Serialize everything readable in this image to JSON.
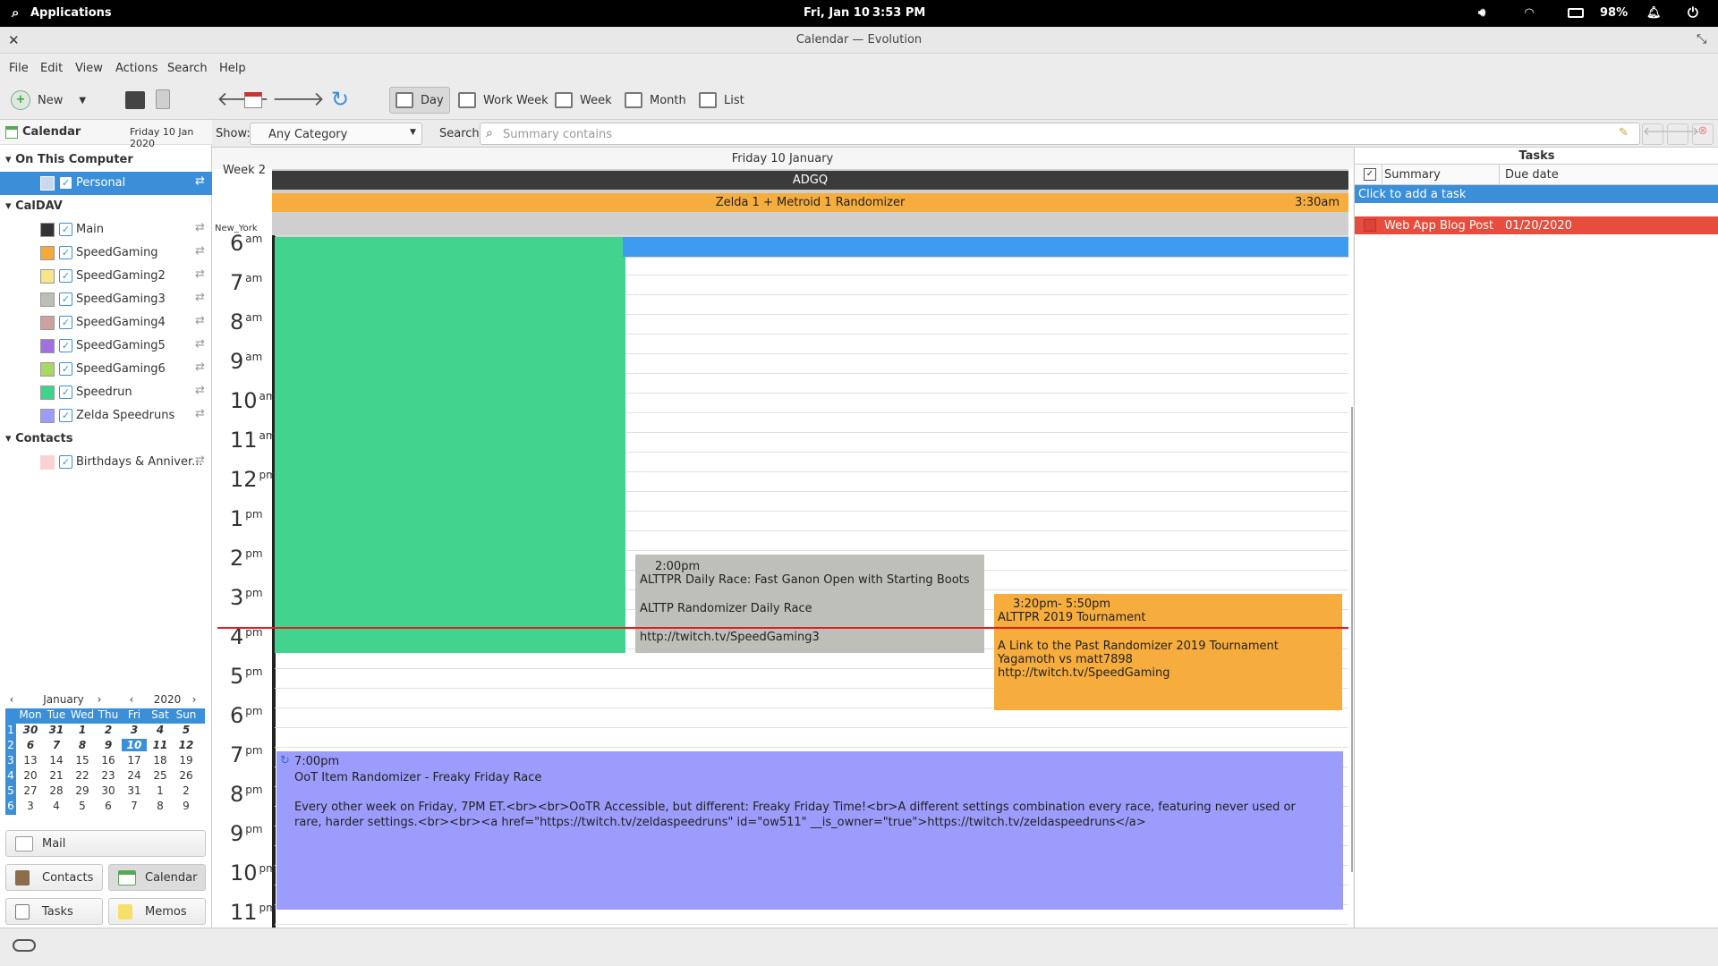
{
  "topbar": {
    "applications": "Applications",
    "date": "Fri, Jan 10",
    "time": "3:53 PM",
    "battery": "98%"
  },
  "window": {
    "title": "Calendar — Evolution"
  },
  "menu": [
    "File",
    "Edit",
    "View",
    "Actions",
    "Search",
    "Help"
  ],
  "toolbar": {
    "new_label": "New",
    "views": [
      "Day",
      "Work Week",
      "Week",
      "Month",
      "List"
    ],
    "active_view": "Day"
  },
  "sidebar": {
    "title": "Calendar",
    "date": "Friday 10 Jan 2020",
    "groups": [
      {
        "name": "On This Computer",
        "items": [
          {
            "name": "Personal",
            "color": "#c8d8ee",
            "selected": true
          }
        ]
      },
      {
        "name": "CalDAV",
        "items": [
          {
            "name": "Main",
            "color": "#333333"
          },
          {
            "name": "SpeedGaming",
            "color": "#f4a93c"
          },
          {
            "name": "SpeedGaming2",
            "color": "#f6e58a"
          },
          {
            "name": "SpeedGaming3",
            "color": "#bebeb8"
          },
          {
            "name": "SpeedGaming4",
            "color": "#cfa0a0"
          },
          {
            "name": "SpeedGaming5",
            "color": "#a070e0"
          },
          {
            "name": "SpeedGaming6",
            "color": "#a8d860"
          },
          {
            "name": "Speedrun",
            "color": "#3fd48c"
          },
          {
            "name": "Zelda Speedruns",
            "color": "#9c9cfc"
          }
        ]
      },
      {
        "name": "Contacts",
        "items": [
          {
            "name": "Birthdays & Anniver...",
            "color": "#fbd2d2"
          }
        ]
      }
    ]
  },
  "minical": {
    "month": "January",
    "year": "2020",
    "weekday_headers": [
      "Mon",
      "Tue",
      "Wed",
      "Thu",
      "Fri",
      "Sat",
      "Sun"
    ],
    "weeks": [
      {
        "num": "1",
        "days": [
          "30",
          "31",
          "1",
          "2",
          "3",
          "4",
          "5"
        ]
      },
      {
        "num": "2",
        "days": [
          "6",
          "7",
          "8",
          "9",
          "10",
          "11",
          "12"
        ]
      },
      {
        "num": "3",
        "days": [
          "13",
          "14",
          "15",
          "16",
          "17",
          "18",
          "19"
        ]
      },
      {
        "num": "4",
        "days": [
          "20",
          "21",
          "22",
          "23",
          "24",
          "25",
          "26"
        ]
      },
      {
        "num": "5",
        "days": [
          "27",
          "28",
          "29",
          "30",
          "31",
          "1",
          "2"
        ]
      },
      {
        "num": "6",
        "days": [
          "3",
          "4",
          "5",
          "6",
          "7",
          "8",
          "9"
        ]
      }
    ],
    "today": "10"
  },
  "switcher": [
    "Mail",
    "Contacts",
    "Calendar",
    "Tasks",
    "Memos"
  ],
  "filter": {
    "show_label": "Show:",
    "category": "Any Category",
    "search_label": "Search:",
    "search_placeholder": "Summary contains"
  },
  "dayview": {
    "header": "Friday 10 January",
    "week": "Week 2",
    "timezone": "New_York",
    "allday": [
      {
        "title": "ADGQ"
      },
      {
        "title": "Zelda 1 + Metroid 1 Randomizer",
        "time": "3:30am"
      }
    ],
    "hours": [
      {
        "h": "6",
        "p": "am"
      },
      {
        "h": "7",
        "p": "am"
      },
      {
        "h": "8",
        "p": "am"
      },
      {
        "h": "9",
        "p": "am"
      },
      {
        "h": "10",
        "p": "am"
      },
      {
        "h": "11",
        "p": "am"
      },
      {
        "h": "12",
        "p": "pm"
      },
      {
        "h": "1",
        "p": "pm"
      },
      {
        "h": "2",
        "p": "pm"
      },
      {
        "h": "3",
        "p": "pm"
      },
      {
        "h": "4",
        "p": "pm"
      },
      {
        "h": "5",
        "p": "pm"
      },
      {
        "h": "6",
        "p": "pm"
      },
      {
        "h": "7",
        "p": "pm"
      },
      {
        "h": "8",
        "p": "pm"
      },
      {
        "h": "9",
        "p": "pm"
      },
      {
        "h": "10",
        "p": "pm"
      },
      {
        "h": "11",
        "p": "pm"
      }
    ],
    "events": {
      "alttpr_daily": {
        "time": "2:00pm",
        "title": "ALTTPR Daily Race: Fast Ganon Open with Starting Boots",
        "desc": "ALTTP Randomizer Daily Race",
        "url": "http://twitch.tv/SpeedGaming3"
      },
      "alttpr_2019": {
        "time": "3:20pm- 5:50pm",
        "title": "ALTTPR 2019 Tournament",
        "desc1": "A Link to the Past Randomizer 2019 Tournament",
        "desc2": "Yagamoth vs matt7898",
        "url": "http://twitch.tv/SpeedGaming"
      },
      "oot": {
        "time": "7:00pm",
        "title": "OoT Item Randomizer - Freaky Friday Race",
        "desc": "Every other week on Friday, 7PM ET.<br><br>OoTR Accessible, but different: Freaky Friday Time!<br>A different settings combination every race, featuring never used or rare, harder settings.<br><br><a href=\"https://twitch.tv/zeldaspeedruns\" id=\"ow511\" __is_owner=\"true\">https://twitch.tv/zeldaspeedruns</a>"
      }
    }
  },
  "tasks": {
    "title": "Tasks",
    "col_summary": "Summary",
    "col_due": "Due date",
    "add_hint": "Click to add a task",
    "items": [
      {
        "summary": "Web App Blog Post",
        "due": "01/20/2020"
      }
    ]
  },
  "colors": {
    "speedrun": "#42d48e",
    "blue_event": "#3d9cf0",
    "gray_event": "#bfbfb9",
    "orange_event": "#f6ad3e",
    "purple_event": "#9c9cfc",
    "selection": "#3b8fd9",
    "now_line": "#e02020",
    "overdue_task": "#e74c3c"
  }
}
